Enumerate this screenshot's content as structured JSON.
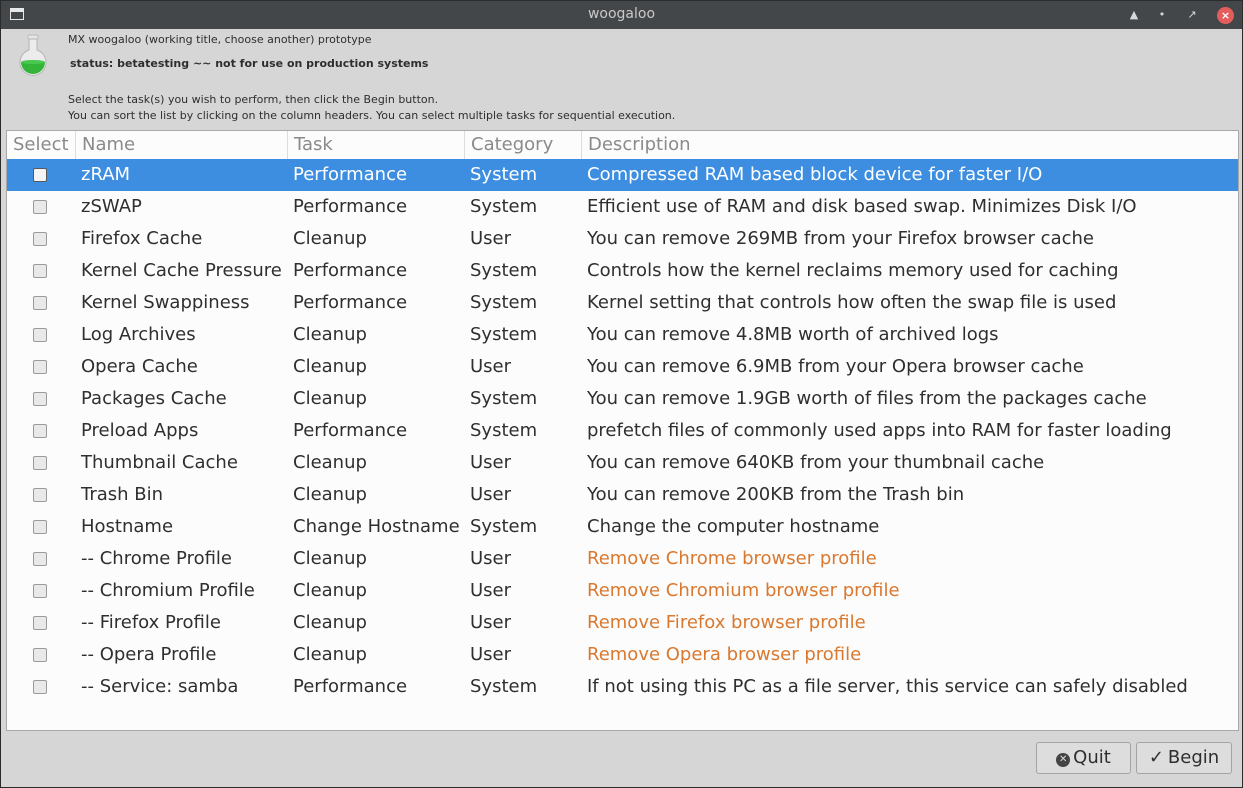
{
  "window": {
    "title": "woogaloo",
    "controls": [
      "arrow-up-icon",
      "minimize-icon",
      "maximize-icon",
      "close-icon"
    ]
  },
  "header": {
    "app_line": "MX woogaloo (working title, choose another) prototype",
    "status_line": "status: betatesting ~~ not for use on production systems",
    "instruction_1": "Select the task(s) you wish to perform, then click the Begin button.",
    "instruction_2": "You can sort the list by clicking on the column headers. You can select multiple tasks for sequential execution."
  },
  "table": {
    "columns": [
      "Select",
      "Name",
      "Task",
      "Category",
      "Description"
    ],
    "rows": [
      {
        "name": "zRAM",
        "task": "Performance",
        "category": "System",
        "description": "Compressed RAM based block device for faster I/O",
        "selected": true,
        "highlight": false
      },
      {
        "name": "zSWAP",
        "task": "Performance",
        "category": "System",
        "description": "Efficient use of RAM and disk based swap. Minimizes Disk I/O",
        "selected": false,
        "highlight": false
      },
      {
        "name": "Firefox Cache",
        "task": "Cleanup",
        "category": "User",
        "description": "You can remove 269MB from your Firefox browser cache",
        "selected": false,
        "highlight": false
      },
      {
        "name": "Kernel Cache Pressure",
        "task": "Performance",
        "category": "System",
        "description": "Controls how the kernel reclaims memory used for caching",
        "selected": false,
        "highlight": false
      },
      {
        "name": "Kernel Swappiness",
        "task": "Performance",
        "category": "System",
        "description": "Kernel setting that controls how often the swap file is used",
        "selected": false,
        "highlight": false
      },
      {
        "name": "Log Archives",
        "task": "Cleanup",
        "category": "System",
        "description": "You can remove 4.8MB worth of archived logs",
        "selected": false,
        "highlight": false
      },
      {
        "name": "Opera Cache",
        "task": "Cleanup",
        "category": "User",
        "description": "You can remove 6.9MB from your Opera browser cache",
        "selected": false,
        "highlight": false
      },
      {
        "name": "Packages Cache",
        "task": "Cleanup",
        "category": "System",
        "description": "You can remove 1.9GB worth of files from the packages cache",
        "selected": false,
        "highlight": false
      },
      {
        "name": "Preload Apps",
        "task": "Performance",
        "category": "System",
        "description": "prefetch files of commonly used apps into RAM for faster loading",
        "selected": false,
        "highlight": false
      },
      {
        "name": "Thumbnail Cache",
        "task": "Cleanup",
        "category": "User",
        "description": "You can remove 640KB from your thumbnail cache",
        "selected": false,
        "highlight": false
      },
      {
        "name": "Trash Bin",
        "task": "Cleanup",
        "category": "User",
        "description": "You can remove 200KB from the Trash bin",
        "selected": false,
        "highlight": false
      },
      {
        "name": "Hostname",
        "task": "Change Hostname",
        "category": "System",
        "description": "Change the computer hostname",
        "selected": false,
        "highlight": false
      },
      {
        "name": " -- Chrome Profile",
        "task": "Cleanup",
        "category": "User",
        "description": "Remove Chrome browser profile",
        "selected": false,
        "highlight": true
      },
      {
        "name": " -- Chromium Profile",
        "task": "Cleanup",
        "category": "User",
        "description": "Remove Chromium browser profile",
        "selected": false,
        "highlight": true
      },
      {
        "name": " -- Firefox Profile",
        "task": "Cleanup",
        "category": "User",
        "description": "Remove Firefox browser profile",
        "selected": false,
        "highlight": true
      },
      {
        "name": " -- Opera Profile",
        "task": "Cleanup",
        "category": "User",
        "description": "Remove Opera browser profile",
        "selected": false,
        "highlight": true
      },
      {
        "name": " -- Service: samba",
        "task": "Performance",
        "category": "System",
        "description": "If not using this PC as a file server, this service can safely disabled",
        "selected": false,
        "highlight": false
      }
    ]
  },
  "buttons": {
    "quit_label": "Quit",
    "begin_label": "Begin"
  },
  "colors": {
    "selection": "#3d8ee0",
    "warning_text": "#d9782f",
    "titlebar": "#444749"
  }
}
